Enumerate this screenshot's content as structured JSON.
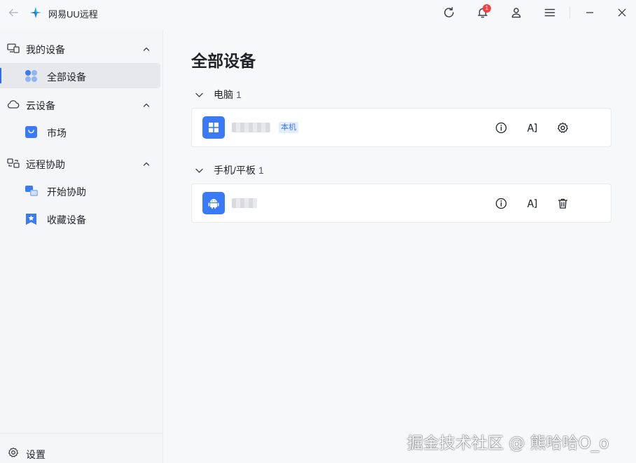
{
  "app": {
    "title": "网易UU远程",
    "notification_count": "1"
  },
  "sidebar": {
    "groups": [
      {
        "label": "我的设备",
        "items": [
          {
            "label": "全部设备",
            "active": true
          }
        ]
      },
      {
        "label": "云设备",
        "items": [
          {
            "label": "市场"
          }
        ]
      },
      {
        "label": "远程协助",
        "items": [
          {
            "label": "开始协助"
          },
          {
            "label": "收藏设备"
          }
        ]
      }
    ],
    "settings_label": "设置"
  },
  "main": {
    "title": "全部设备",
    "sections": [
      {
        "label": "电脑",
        "count": "1",
        "devices": [
          {
            "name": "████████",
            "tag": "本机",
            "actions": [
              "info-icon",
              "remote-icon",
              "gear-icon"
            ]
          }
        ]
      },
      {
        "label": "手机/平板",
        "count": "1",
        "devices": [
          {
            "name": "█████",
            "actions": [
              "info-icon",
              "remote-icon",
              "trash-icon"
            ]
          }
        ]
      }
    ]
  },
  "watermark": "掘金技术社区 @ 熊哈哈O_o",
  "colors": {
    "accent": "#2f6bff",
    "device_icon": "#3a7af6",
    "badge": "#f53f3f"
  }
}
